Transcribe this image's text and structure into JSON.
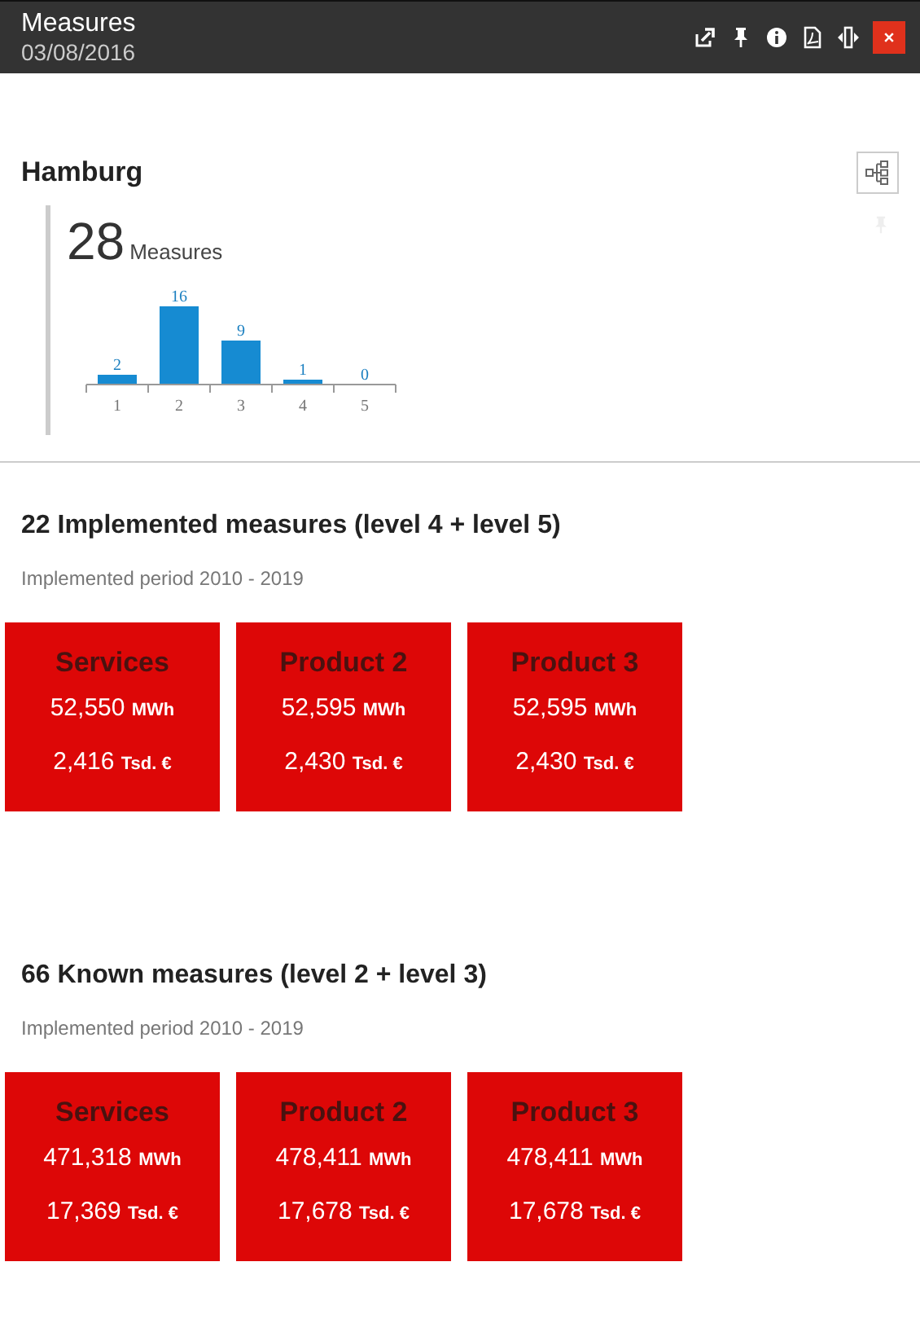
{
  "window": {
    "title": "Measures",
    "subtitle": "03/08/2016"
  },
  "region": {
    "title": "Hamburg",
    "total": "28",
    "total_label": "Measures",
    "chart_data": {
      "type": "bar",
      "categories": [
        "1",
        "2",
        "3",
        "4",
        "5"
      ],
      "values": [
        2,
        16,
        9,
        1,
        0
      ],
      "data_labels": true
    }
  },
  "sections": [
    {
      "title": "22 Implemented measures (level 4 + level 5)",
      "period": "Implemented period 2010 - 2019",
      "tiles": [
        {
          "name": "Services",
          "energy": "52,550",
          "energy_unit": "MWh",
          "cost": "2,416",
          "cost_unit": "Tsd. €"
        },
        {
          "name": "Product 2",
          "energy": "52,595",
          "energy_unit": "MWh",
          "cost": "2,430",
          "cost_unit": "Tsd. €"
        },
        {
          "name": "Product 3",
          "energy": "52,595",
          "energy_unit": "MWh",
          "cost": "2,430",
          "cost_unit": "Tsd. €"
        }
      ]
    },
    {
      "title": "66 Known measures (level 2 + level 3)",
      "period": "Implemented period 2010 - 2019",
      "tiles": [
        {
          "name": "Services",
          "energy": "471,318",
          "energy_unit": "MWh",
          "cost": "17,369",
          "cost_unit": "Tsd. €"
        },
        {
          "name": "Product 2",
          "energy": "478,411",
          "energy_unit": "MWh",
          "cost": "17,678",
          "cost_unit": "Tsd. €"
        },
        {
          "name": "Product 3",
          "energy": "478,411",
          "energy_unit": "MWh",
          "cost": "17,678",
          "cost_unit": "Tsd. €"
        }
      ]
    }
  ]
}
